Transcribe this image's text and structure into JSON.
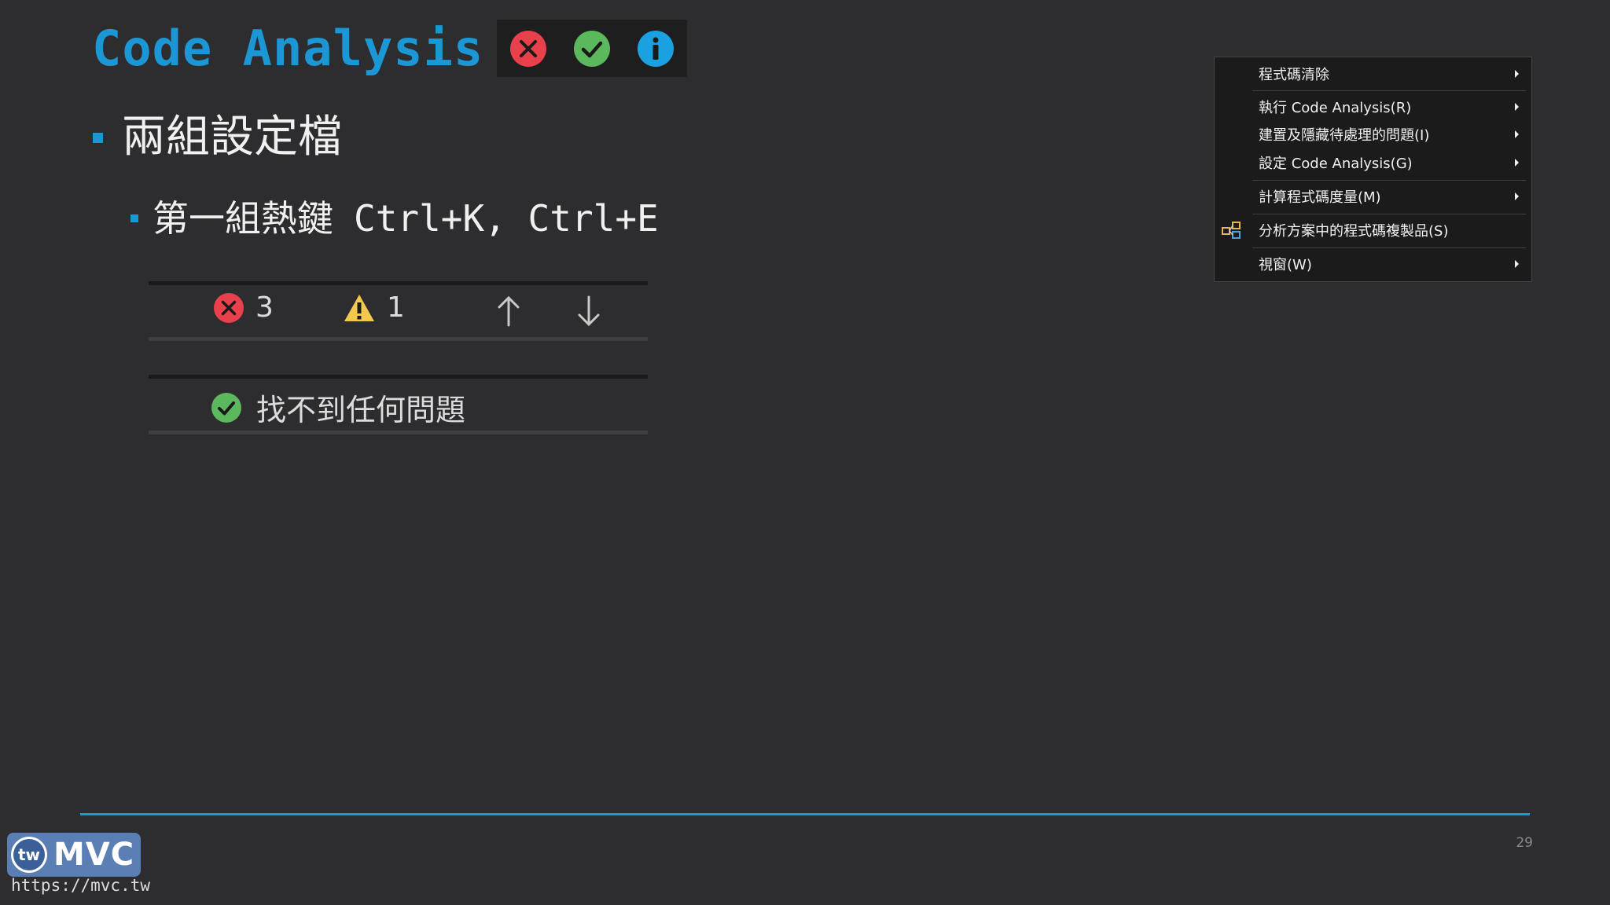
{
  "slide": {
    "title": "Code Analysis",
    "title_icons": [
      "error-icon",
      "success-icon",
      "info-icon"
    ],
    "bullet_level1": "兩組設定檔",
    "bullet_level2_text": "第一組熱鍵",
    "bullet_level2_hotkeys": "Ctrl+K, Ctrl+E"
  },
  "status_bar_issues": {
    "error_count": "3",
    "warning_count": "1",
    "prev_icon": "arrow-up-icon",
    "next_icon": "arrow-down-icon"
  },
  "status_bar_clean": {
    "message": "找不到任何問題"
  },
  "context_menu": {
    "items": [
      {
        "label": "程式碼清除",
        "has_submenu": true
      },
      {
        "label": "執行 Code Analysis(R)",
        "has_submenu": true
      },
      {
        "label": "建置及隱藏待處理的問題(I)",
        "has_submenu": true
      },
      {
        "label": "設定 Code Analysis(G)",
        "has_submenu": true
      },
      {
        "label": "計算程式碼度量(M)",
        "has_submenu": true
      },
      {
        "label": "分析方案中的程式碼複製品(S)",
        "has_submenu": false,
        "icon": "code-clone-icon"
      },
      {
        "label": "視窗(W)",
        "has_submenu": true
      }
    ]
  },
  "footer": {
    "page_number": "29",
    "logo_badge": "tw",
    "logo_text": "MVC",
    "url": "https://mvc.tw"
  },
  "colors": {
    "accent": "#1c97d6",
    "background": "#2d2d30",
    "error": "#e8414c",
    "success": "#5cb85c",
    "info": "#1ba1e2",
    "warning": "#f2c94c"
  }
}
